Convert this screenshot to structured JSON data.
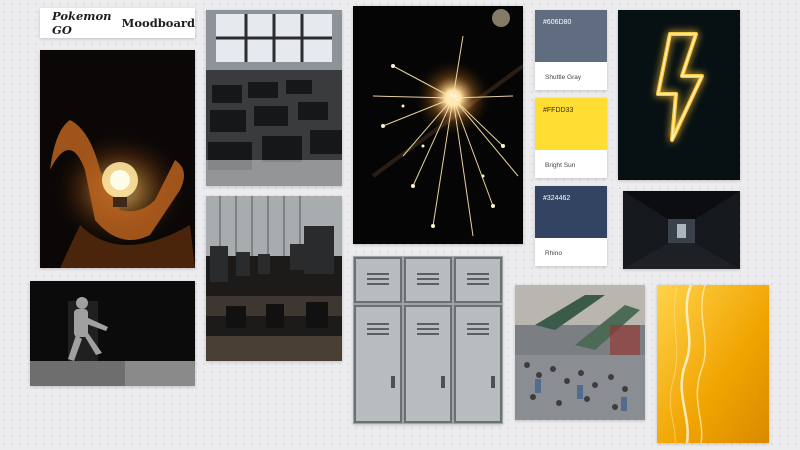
{
  "board": {
    "title_brand": "Pokemon GO",
    "title_rest": "Moodboard"
  },
  "swatches": [
    {
      "hex": "#606D80",
      "name": "Shuttle Gray",
      "color": "#606d80",
      "hex_text_color": "#ffffff"
    },
    {
      "hex": "#FFDD33",
      "name": "Bright Sun",
      "color": "#ffdd33",
      "hex_text_color": "#3a3000"
    },
    {
      "hex": "#324462",
      "name": "Rhino",
      "color": "#324462",
      "hex_text_color": "#ffffff"
    }
  ],
  "photos": [
    {
      "id": "lightbulb-in-hand",
      "subject": "glowing light bulb held in hand"
    },
    {
      "id": "classroom-desks",
      "subject": "empty classroom desks by window"
    },
    {
      "id": "sparkler",
      "subject": "burning sparkler"
    },
    {
      "id": "neon-bolt",
      "subject": "yellow neon lightning bolt"
    },
    {
      "id": "dark-corridor",
      "subject": "dark corridor"
    },
    {
      "id": "running-figure",
      "subject": "blurred running figure in black and white"
    },
    {
      "id": "computer-lab",
      "subject": "computer lab with monitors"
    },
    {
      "id": "school-lockers",
      "subject": "grey school lockers"
    },
    {
      "id": "crowd-escalators",
      "subject": "crowd on escalators in mall"
    },
    {
      "id": "yellow-abstract",
      "subject": "yellow abstract light streaks"
    }
  ]
}
